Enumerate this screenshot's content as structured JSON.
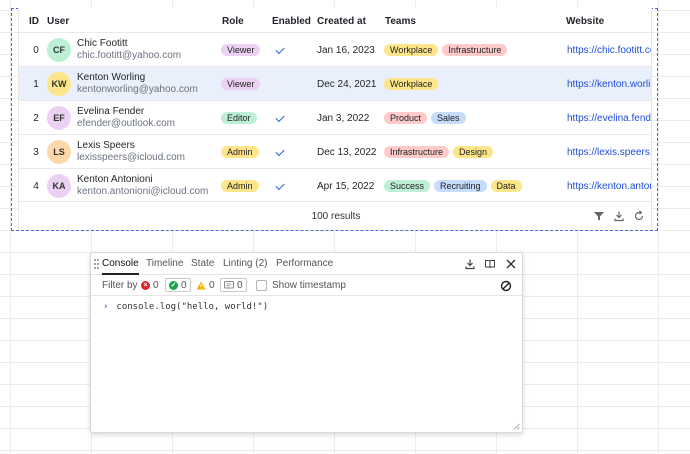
{
  "table": {
    "columns": {
      "id": "ID",
      "user": "User",
      "role": "Role",
      "enabled": "Enabled",
      "created": "Created at",
      "teams": "Teams",
      "website": "Website"
    },
    "rows": [
      {
        "id": "0",
        "initials": "CF",
        "avatar_color": "#bdf0d3",
        "name": "Chic Footitt",
        "email": "chic.footitt@yahoo.com",
        "role": "Viewer",
        "role_color": "#ecd1f3",
        "enabled": true,
        "created": "Jan 16, 2023",
        "teams": [
          {
            "label": "Workplace",
            "color": "#fde68a"
          },
          {
            "label": "Infrastructure",
            "color": "#fecaca"
          }
        ],
        "website": "https://chic.footitt.com"
      },
      {
        "id": "1",
        "initials": "KW",
        "avatar_color": "#fde68a",
        "name": "Kenton Worling",
        "email": "kentonworling@yahoo.com",
        "role": "Viewer",
        "role_color": "#ecd1f3",
        "enabled": false,
        "created": "Dec 24, 2021",
        "teams": [
          {
            "label": "Workplace",
            "color": "#fde68a"
          }
        ],
        "website": "https://kenton.worling.com"
      },
      {
        "id": "2",
        "initials": "EF",
        "avatar_color": "#ecd1f3",
        "name": "Evelina Fender",
        "email": "efender@outlook.com",
        "role": "Editor",
        "role_color": "#bdf0d3",
        "enabled": true,
        "created": "Jan 3, 2022",
        "teams": [
          {
            "label": "Product",
            "color": "#fecaca"
          },
          {
            "label": "Sales",
            "color": "#c7dbfb"
          }
        ],
        "website": "https://evelina.fender.com"
      },
      {
        "id": "3",
        "initials": "LS",
        "avatar_color": "#fed7aa",
        "name": "Lexis Speers",
        "email": "lexisspeers@icloud.com",
        "role": "Admin",
        "role_color": "#fde68a",
        "enabled": true,
        "created": "Dec 13, 2022",
        "teams": [
          {
            "label": "Infrastructure",
            "color": "#fecaca"
          },
          {
            "label": "Design",
            "color": "#fde68a"
          }
        ],
        "website": "https://lexis.speers.com"
      },
      {
        "id": "4",
        "initials": "KA",
        "avatar_color": "#ecd1f3",
        "name": "Kenton Antonioni",
        "email": "kenton.antonioni@icloud.com",
        "role": "Admin",
        "role_color": "#fde68a",
        "enabled": true,
        "created": "Apr 15, 2022",
        "teams": [
          {
            "label": "Success",
            "color": "#bdf0d3"
          },
          {
            "label": "Recruiting",
            "color": "#c7dbfb"
          },
          {
            "label": "Data",
            "color": "#fde68a"
          }
        ],
        "website": "https://kenton.antonioni.com"
      }
    ],
    "selected_row": "1",
    "results_label": "100 results",
    "footer_icons": [
      "filter-icon",
      "download-icon",
      "refresh-icon"
    ]
  },
  "console": {
    "tabs": [
      "Console",
      "Timeline",
      "State",
      "Linting (2)",
      "Performance"
    ],
    "active_tab": "Console",
    "header_icons": [
      "download-icon",
      "book-icon",
      "close-icon"
    ],
    "filter_label": "Filter by",
    "errors_count": "0",
    "success_count": "0",
    "warnings_count": "0",
    "info_count": "0",
    "show_timestamp_label": "Show timestamp",
    "log_line": "console.log(\"hello, world!\")",
    "prompt_symbol": "›"
  }
}
